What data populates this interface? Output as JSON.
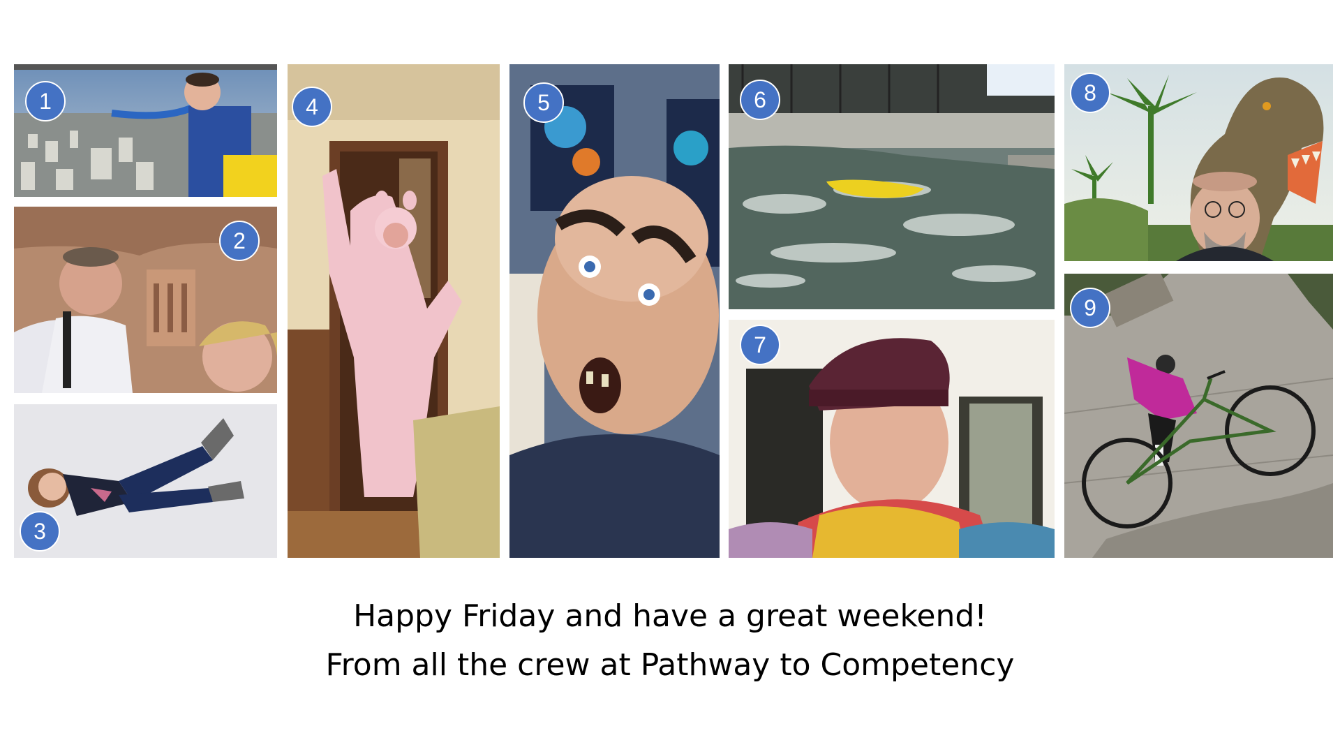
{
  "photos": [
    {
      "number": "1",
      "description_icon": "bungee-jump-photo"
    },
    {
      "number": "2",
      "description_icon": "petra-selfie-photo"
    },
    {
      "number": "3",
      "description_icon": "levitating-woman-photo"
    },
    {
      "number": "4",
      "description_icon": "pig-costume-photo"
    },
    {
      "number": "5",
      "description_icon": "funny-face-photo"
    },
    {
      "number": "6",
      "description_icon": "whitewater-kayak-photo"
    },
    {
      "number": "7",
      "description_icon": "scarf-hat-selfie-photo"
    },
    {
      "number": "8",
      "description_icon": "dinosaur-selfie-photo"
    },
    {
      "number": "9",
      "description_icon": "cyclist-lying-photo"
    }
  ],
  "caption": {
    "line1": "Happy Friday and have a great weekend!",
    "line2": "From all the crew at Pathway to Competency"
  },
  "colors": {
    "badge": "#4472c4",
    "background": "#ffffff",
    "text": "#000000"
  }
}
